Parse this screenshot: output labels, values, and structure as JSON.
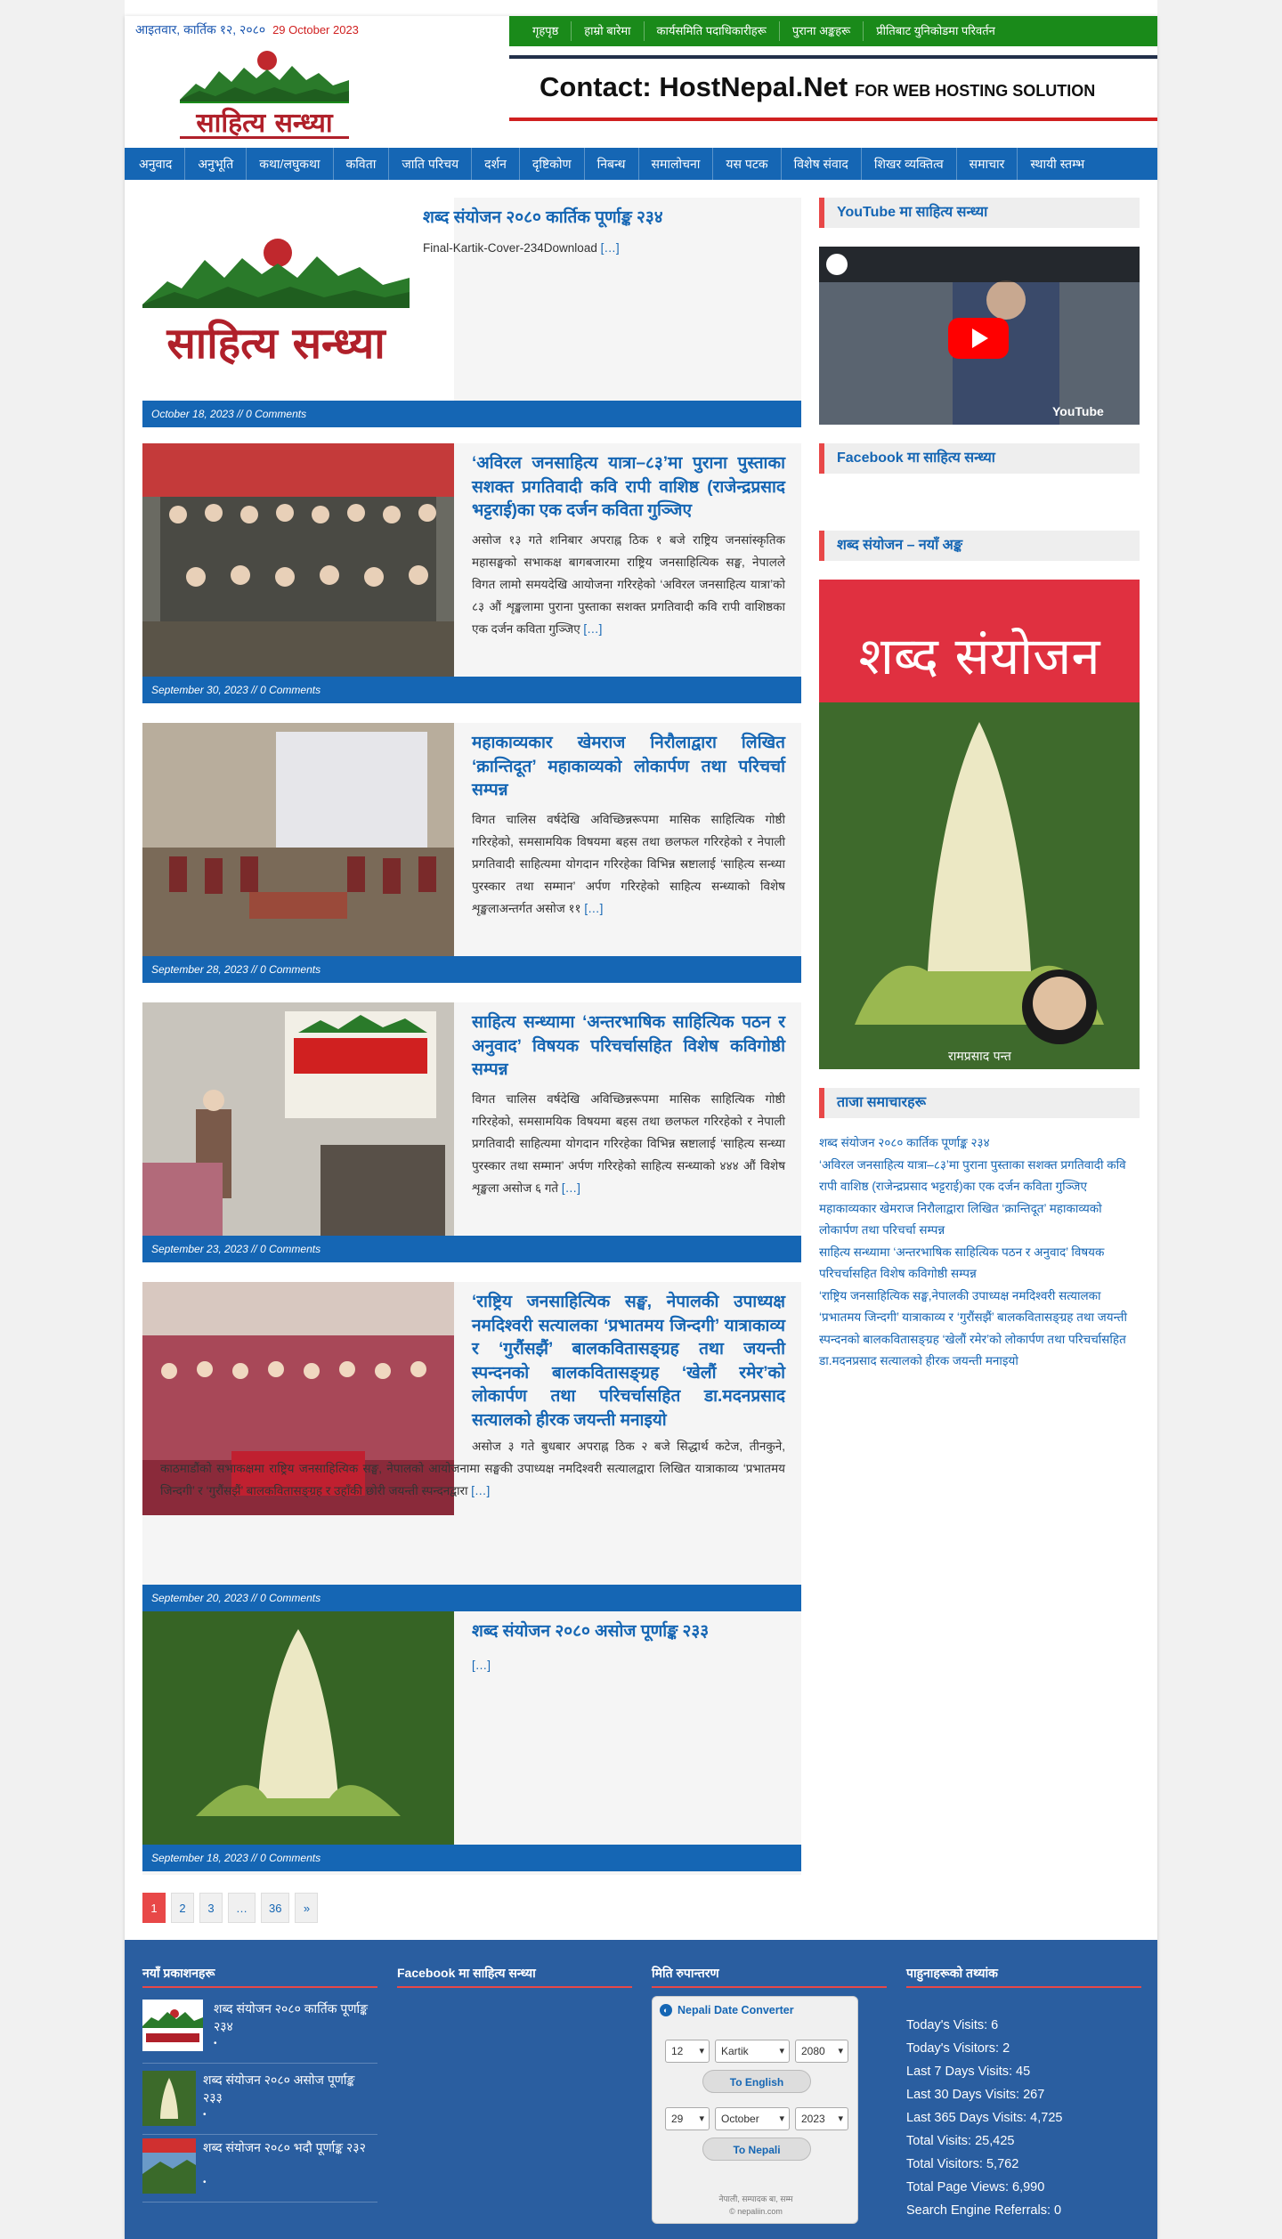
{
  "header": {
    "date_np": "आइतवार, कार्तिक १२, २०८०",
    "date_en": "29 October 2023",
    "logo_text": "साहित्य सन्ध्या",
    "top_nav": [
      "गृहपृष्ठ",
      "हाम्रो बारेमा",
      "कार्यसमिति पदाधिकारीहरू",
      "पुराना अङ्कहरू",
      "प्रीतिबाट युनिकोडमा परिवर्तन"
    ],
    "ad_title": "Contact: HostNepal.Net",
    "ad_sub": "FOR WEB HOSTING SOLUTION"
  },
  "main_nav": [
    "अनुवाद",
    "अनुभूति",
    "कथा/लघुकथा",
    "कविता",
    "जाति परिचय",
    "दर्शन",
    "दृष्टिकोण",
    "निबन्ध",
    "समालोचना",
    "यस पटक",
    "विशेष संवाद",
    "शिखर व्यक्तित्व",
    "समाचार",
    "स्थायी स्तम्भ"
  ],
  "posts": [
    {
      "title": "शब्द संयोजन २०८० कार्तिक पूर्णाङ्क २३४",
      "excerpt": "Final-Kartik-Cover-234Download",
      "more": "[…]",
      "meta": "October 18, 2023 // 0 Comments"
    },
    {
      "title": "‘अविरल जनसाहित्य यात्रा–८३’मा पुराना पुस्ताका सशक्त प्रगतिवादी कवि रापी वाशिष्ठ (राजेन्द्रप्रसाद भट्टराई)का एक दर्जन कविता गुञ्जिए",
      "excerpt": "असोज १३ गते शनिबार अपराह्न ठिक १ बजे राष्ट्रिय जनसांस्कृतिक महासङ्घको सभाकक्ष बागबजारमा राष्ट्रिय जनसाहित्यिक सङ्घ, नेपालले विगत लामो समयदेखि आयोजना गरिरहेको ‘अविरल जनसाहित्य यात्रा’को ८३ औं शृङ्खलामा पुराना पुस्ताका सशक्त प्रगतिवादी कवि रापी वाशिष्ठका एक दर्जन कविता गुञ्जिए",
      "more": "[…]",
      "meta": "September 30, 2023 // 0 Comments"
    },
    {
      "title": "महाकाव्यकार खेमराज निरौलाद्वारा लिखित ‘क्रान्तिदूत’ महाकाव्यको लोकार्पण तथा परिचर्चा सम्पन्न",
      "excerpt": "विगत चालिस वर्षदेखि अविच्छिन्नरूपमा मासिक साहित्यिक गोष्ठी गरिरहेको, समसामयिक विषयमा बहस तथा छलफल गरिरहेको र नेपाली प्रगतिवादी साहित्यमा योगदान गरिरहेका विभिन्न स्रष्टालाई ‘साहित्य सन्ध्या पुरस्कार तथा सम्मान’ अर्पण गरिरहेको साहित्य सन्ध्याको विशेष शृङ्खलाअन्तर्गत असोज ११",
      "more": "[…]",
      "meta": "September 28, 2023 // 0 Comments"
    },
    {
      "title": "साहित्य सन्ध्यामा ‘अन्तरभाषिक साहित्यिक पठन र अनुवाद’ विषयक परिचर्चासहित विशेष कविगोष्ठी सम्पन्न",
      "excerpt": "विगत चालिस वर्षदेखि अविच्छिन्नरूपमा मासिक साहित्यिक गोष्ठी गरिरहेको, समसामयिक विषयमा बहस तथा छलफल गरिरहेको र नेपाली प्रगतिवादी साहित्यमा योगदान गरिरहेका विभिन्न स्रष्टालाई ‘साहित्य सन्ध्या पुरस्कार तथा सम्मान’ अर्पण गरिरहेको साहित्य सन्ध्याको ४४४ औं विशेष शृङ्खला असोज ६ गते",
      "more": "[…]",
      "meta": "September 23, 2023 // 0 Comments"
    },
    {
      "title": "‘राष्ट्रिय जनसाहित्यिक सङ्घ, नेपालकी उपाध्यक्ष नमदिश्वरी सत्यालका ‘प्रभातमय जिन्दगी’ यात्राकाव्य र ‘गुरौंसझैं’ बालकवितासङ्ग्रह तथा जयन्ती स्पन्दनको बालकवितासङ्ग्रह ‘खेलौं रमेर’को लोकार्पण तथा परिचर्चासहित डा.मदनप्रसाद सत्यालको हीरक जयन्ती मनाइयो",
      "excerpt": "असोज ३ गते बुधबार अपराह्न ठिक २ बजे सिद्धार्थ कटेज, तीनकुने, काठमाडौंको सभाकक्षमा राष्ट्रिय जनसाहित्यिक सङ्घ, नेपालको आयोजनामा सङ्घकी उपाध्यक्ष नमदिश्वरी सत्यालद्वारा लिखित यात्राकाव्य ‘प्रभातमय जिन्दगी’ र ‘गुरौंसझैं’ बालकवितासङ्ग्रह र उहाँकी छोरी जयन्ती स्पन्दनद्वारा",
      "more": "[…]",
      "meta": "September 20, 2023 // 0 Comments"
    },
    {
      "title": "शब्द संयोजन २०८० असोज पूर्णाङ्क २३३",
      "excerpt": "",
      "more": "[…]",
      "meta": "September 18, 2023 // 0 Comments"
    }
  ],
  "pagination": [
    "1",
    "2",
    "3",
    "…",
    "36",
    "»"
  ],
  "sidebar": {
    "youtube_heading": "YouTube मा साहित्य सन्ध्या",
    "youtube_label": "YouTube",
    "facebook_heading": "Facebook मा साहित्य सन्ध्या",
    "magazine_heading": "शब्द संयोजन – नयाँ अङ्क",
    "magazine_title": "शब्द संयोजन",
    "magazine_caption": "रामप्रसाद पन्त",
    "news_heading": "ताजा समाचारहरू",
    "news": [
      "शब्द संयोजन २०८० कार्तिक पूर्णाङ्क २३४",
      "‘अविरल जनसाहित्य यात्रा–८३’मा पुराना पुस्ताका सशक्त प्रगतिवादी कवि रापी वाशिष्ठ (राजेन्द्रप्रसाद भट्टराई)का एक दर्जन कविता गुञ्जिए",
      "महाकाव्यकार खेमराज निरौलाद्वारा लिखित ‘क्रान्तिदूत’ महाकाव्यको लोकार्पण तथा परिचर्चा सम्पन्न",
      "साहित्य सन्ध्यामा ‘अन्तरभाषिक साहित्यिक पठन र अनुवाद’ विषयक परिचर्चासहित विशेष कविगोष्ठी सम्पन्न",
      "‘राष्ट्रिय जनसाहित्यिक सङ्घ,नेपालकी उपाध्यक्ष नमदिश्वरी सत्यालका ‘प्रभातमय जिन्दगी’ यात्राकाव्य र ‘गुरौंसझैं’ बालकवितासङ्ग्रह तथा जयन्ती स्पन्दनको बालकवितासङ्ग्रह ‘खेलौं रमेर’को लोकार्पण तथा परिचर्चासहित डा.मदनप्रसाद सत्यालको हीरक जयन्ती मनाइयो"
    ]
  },
  "footer": {
    "col1_heading": "नयाँ प्रकाशनहरू",
    "col2_heading": "Facebook मा साहित्य सन्ध्या",
    "col3_heading": "मिति रुपान्तरण",
    "col4_heading": "पाहुनाहरूको तथ्यांक",
    "publications": [
      {
        "title": "शब्द संयोजन २०८० कार्तिक पूर्णाङ्क २३४",
        "bullet": "•"
      },
      {
        "title": "शब्द संयोजन २०८० असोज पूर्णाङ्क २३३",
        "bullet": "•"
      },
      {
        "title": "शब्द संयोजन २०८० भदौ पूर्णाङ्क २३२",
        "bullet": "•"
      }
    ],
    "converter": {
      "title": "Nepali Date Converter",
      "np_day": "12",
      "np_month": "Kartik",
      "np_year": "2080",
      "to_english": "To English",
      "en_day": "29",
      "en_month": "October",
      "en_year": "2023",
      "to_nepali": "To Nepali",
      "footer_line": "नेपाली, सम्पादक बा, सम्म",
      "credit": "© nepaliin.com"
    },
    "stats": [
      "Today's Visits: 6",
      "Today's Visitors: 2",
      "Last 7 Days Visits: 45",
      "Last 30 Days Visits: 267",
      "Last 365 Days Visits: 4,725",
      "Total Visits: 25,425",
      "Total Visitors: 5,762",
      "Total Page Views: 6,990",
      "Search Engine Referrals: 0"
    ]
  }
}
